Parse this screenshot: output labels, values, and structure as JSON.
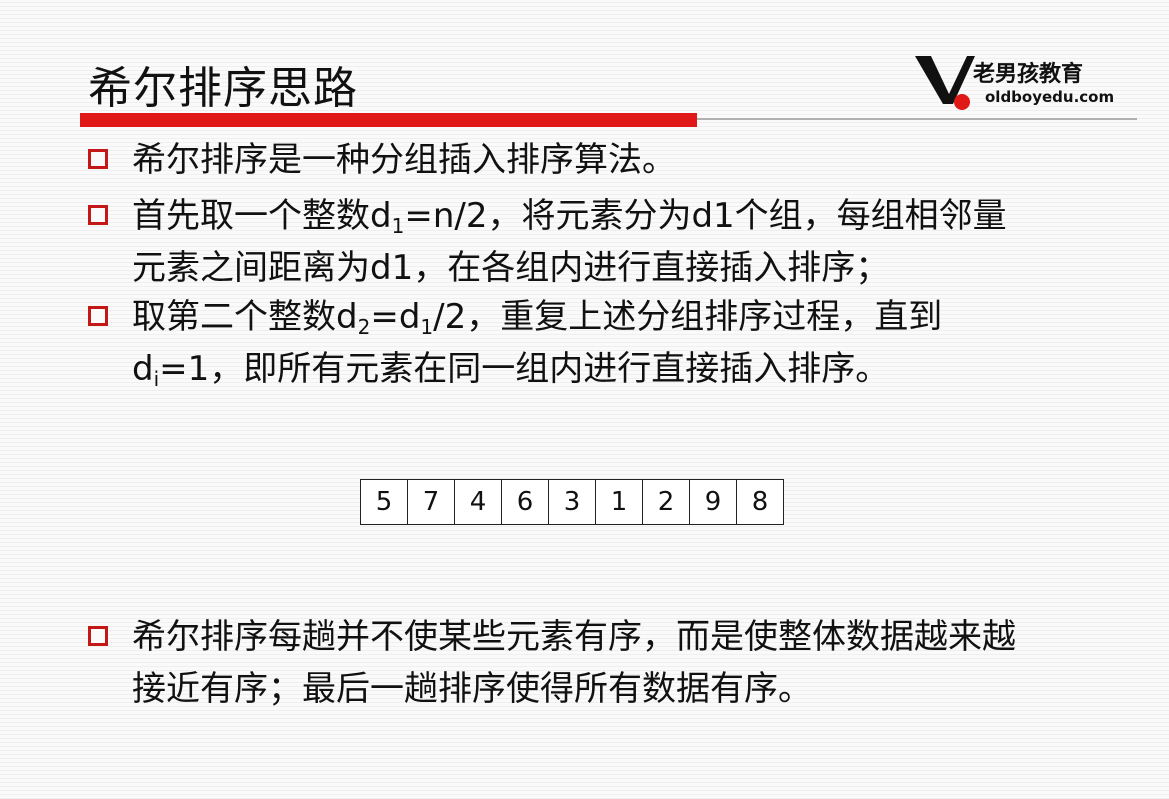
{
  "slide": {
    "title": "希尔排序思路",
    "logo": {
      "brand": "老男孩教育",
      "url": "oldboyedu.com"
    },
    "bullets": [
      {
        "text": "希尔排序是一种分组插入排序算法。"
      },
      {
        "part1": "首先取一个整数d",
        "sub1": "1",
        "part2": "=n/2，将元素分为d1个组，每组相邻量",
        "line2": "元素之间距离为d1，在各组内进行直接插入排序；"
      },
      {
        "part1": "取第二个整数d",
        "sub1": "2",
        "part2": "=d",
        "sub2": "1",
        "part3": "/2，重复上述分组排序过程，直到",
        "line2_part1": "d",
        "line2_sub": "i",
        "line2_part2": "=1，即所有元素在同一组内进行直接插入排序。"
      },
      {
        "line1": "希尔排序每趟并不使某些元素有序，而是使整体数据越来越",
        "line2": "接近有序；最后一趟排序使得所有数据有序。"
      }
    ],
    "array": [
      "5",
      "7",
      "4",
      "6",
      "3",
      "1",
      "2",
      "9",
      "8"
    ]
  },
  "colors": {
    "accent_red": "#e01818",
    "bullet_box": "#c41818",
    "divider_gray": "#b0b0b0"
  }
}
